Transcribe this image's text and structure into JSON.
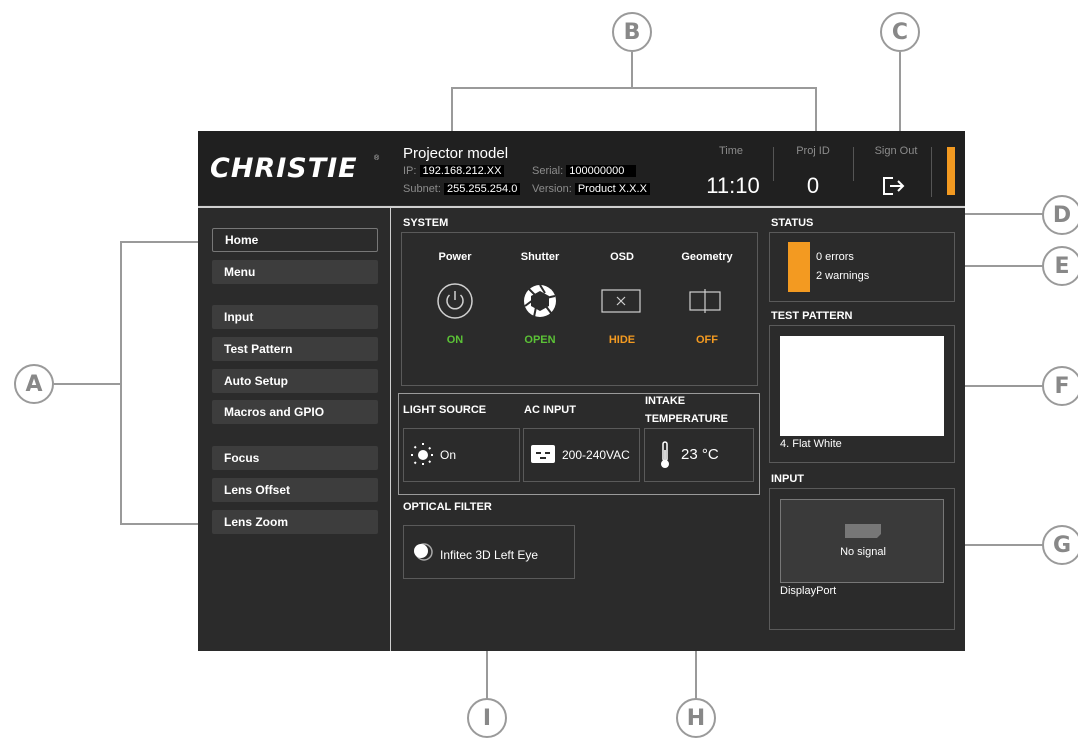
{
  "callouts": [
    "A",
    "B",
    "C",
    "D",
    "E",
    "F",
    "G",
    "H",
    "I"
  ],
  "header": {
    "logo": "CHRISTIE",
    "model": "Projector model",
    "ip_label": "IP:",
    "ip_value": "192.168.212.XX",
    "subnet_label": "Subnet:",
    "subnet_value": "255.255.254.0",
    "serial_label": "Serial:",
    "serial_value": "100000000",
    "version_label": "Version:",
    "version_value": "Product X.X.X",
    "time_label": "Time",
    "time_value": "11:10",
    "proj_id_label": "Proj ID",
    "proj_id_value": "0",
    "sign_out_label": "Sign Out"
  },
  "sidebar": {
    "items": [
      {
        "label": "Home"
      },
      {
        "label": "Menu"
      },
      {
        "label": "Input"
      },
      {
        "label": "Test Pattern"
      },
      {
        "label": "Auto Setup"
      },
      {
        "label": "Macros and GPIO"
      },
      {
        "label": "Focus"
      },
      {
        "label": "Lens Offset"
      },
      {
        "label": "Lens Zoom"
      }
    ]
  },
  "system": {
    "title": "SYSTEM",
    "items": [
      {
        "label": "Power",
        "state": "ON",
        "icon": "power-icon"
      },
      {
        "label": "Shutter",
        "state": "OPEN",
        "icon": "shutter-icon"
      },
      {
        "label": "OSD",
        "state": "HIDE",
        "icon": "osd-icon"
      },
      {
        "label": "Geometry",
        "state": "OFF",
        "icon": "geometry-icon"
      }
    ],
    "colors": {
      "on": "#5bc236",
      "warn": "#f39a21"
    }
  },
  "light_source": {
    "title": "LIGHT SOURCE",
    "value": "On"
  },
  "ac_input": {
    "title": "AC INPUT",
    "value": "200-240VAC"
  },
  "intake": {
    "title_line1": "INTAKE",
    "title_line2": "TEMPERATURE",
    "value": "23 °C"
  },
  "optical_filter": {
    "title": "OPTICAL FILTER",
    "value": "Infitec 3D Left Eye"
  },
  "status": {
    "title": "STATUS",
    "errors": "0 errors",
    "warnings": "2 warnings"
  },
  "test_pattern": {
    "title": "TEST PATTERN",
    "caption": "4. Flat White"
  },
  "input": {
    "title": "INPUT",
    "signal": "No signal",
    "source": "DisplayPort"
  }
}
